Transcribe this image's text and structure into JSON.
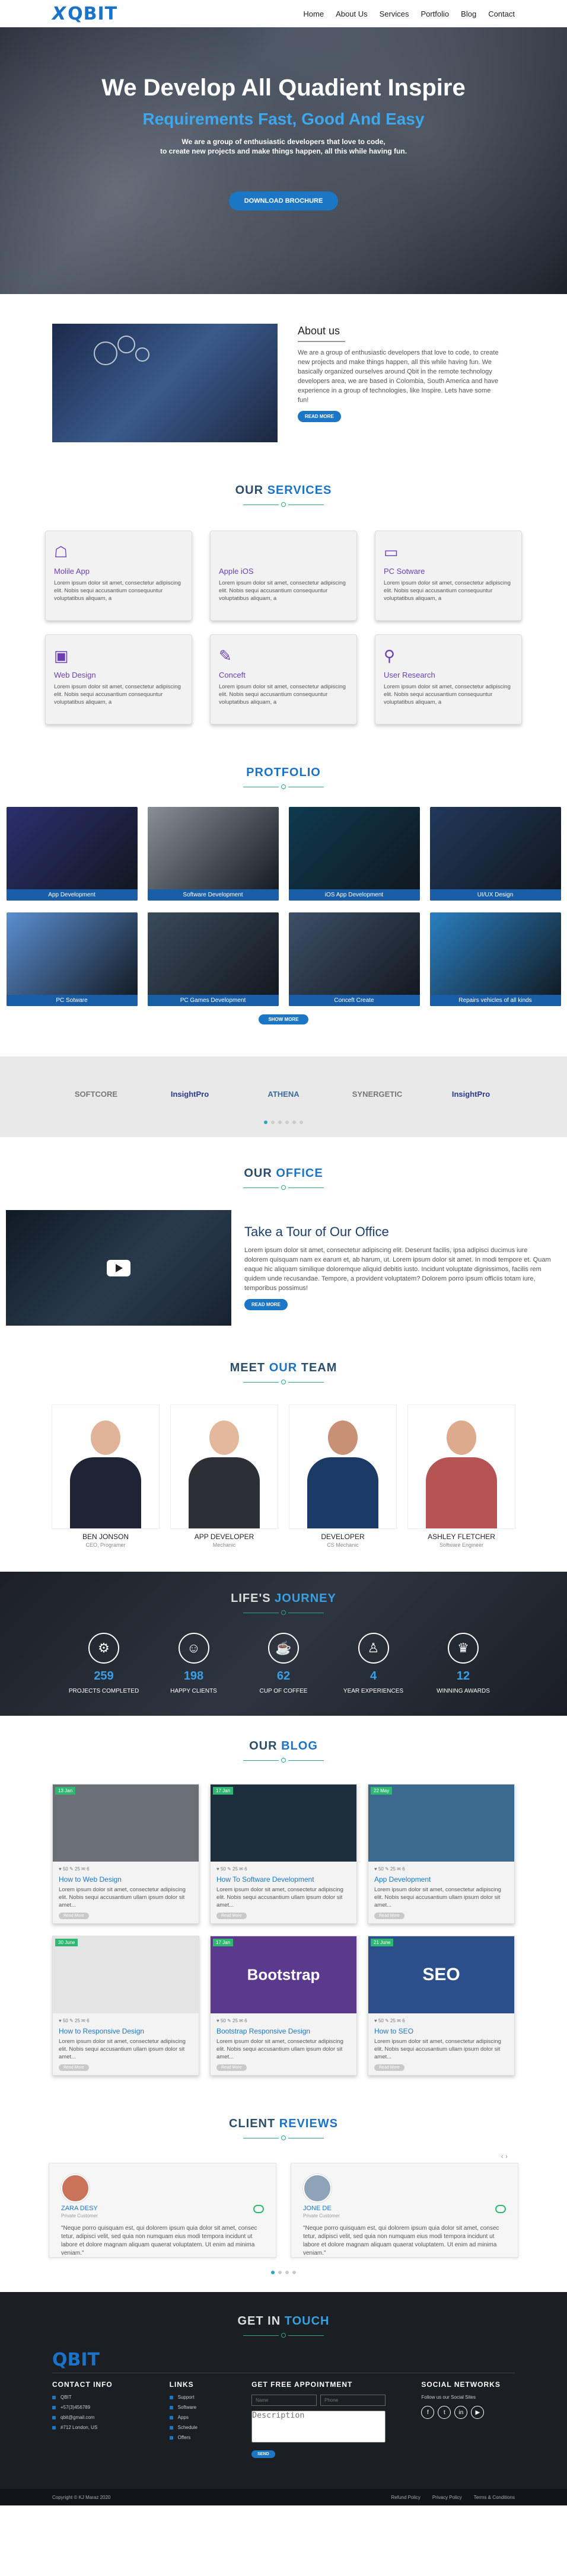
{
  "brand": {
    "logo_mark": "X",
    "logo_text": "QBIT",
    "accent": "#1a73c9"
  },
  "nav": {
    "items": [
      "Home",
      "About Us",
      "Services",
      "Portfolio",
      "Blog",
      "Contact"
    ]
  },
  "hero": {
    "title": "We Develop All Quadient Inspire",
    "subtitle": "Requirements Fast, Good And Easy",
    "line1": "We are a group of enthusiastic developers that love to code,",
    "line2": "to create new projects and make things happen, all this while having fun.",
    "button": "DOWNLOAD BROCHURE"
  },
  "about": {
    "title": "About us",
    "text": "We are a group of enthusiastic developers that love to code, to create new projects and make things happen, all this while having fun. We basically organized ourselves around Qbit in the remote technology developers area, we are based in Colombia, South America and have experience in a group of technologies, like Inspire. Lets have some fun!",
    "button": "READ MORE"
  },
  "services": {
    "title_a": "OUR ",
    "title_b": "SERVICES",
    "items": [
      {
        "icon": "android-icon",
        "glyph": "☖",
        "title": "Molile App",
        "text": "Lorem ipsum dolor sit amet, consectetur adipiscing elit. Nobis sequi accusantium consequuntur voluptatibus aliquam, a"
      },
      {
        "icon": "apple-icon",
        "glyph": "",
        "title": "Apple iOS",
        "text": "Lorem ipsum dolor sit amet, consectetur adipiscing elit. Nobis sequi accusantium consequuntur voluptatibus aliquam, a"
      },
      {
        "icon": "monitor-icon",
        "glyph": "▭",
        "title": "PC Sotware",
        "text": "Lorem ipsum dolor sit amet, consectetur adipiscing elit. Nobis sequi accusantium consequuntur voluptatibus aliquam, a"
      },
      {
        "icon": "web-design-icon",
        "glyph": "▣",
        "title": "Web Design",
        "text": "Lorem ipsum dolor sit amet, consectetur adipiscing elit. Nobis sequi accusantium consequuntur voluptatibus aliquam, a"
      },
      {
        "icon": "idea-icon",
        "glyph": "✎",
        "title": "Conceft",
        "text": "Lorem ipsum dolor sit amet, consectetur adipiscing elit. Nobis sequi accusantium consequuntur voluptatibus aliquam, a"
      },
      {
        "icon": "research-icon",
        "glyph": "⚲",
        "title": "User Research",
        "text": "Lorem ipsum dolor sit amet, consectetur adipiscing elit. Nobis sequi accusantium consequuntur voluptatibus aliquam, a"
      }
    ]
  },
  "portfolio": {
    "title": "PROTFOLIO",
    "items": [
      {
        "label": "App Development",
        "bg": "#2b2f6e"
      },
      {
        "label": "Software Development",
        "bg": "#8a8e96"
      },
      {
        "label": "iOS App Development",
        "bg": "#0e3a4f"
      },
      {
        "label": "UI/UX Design",
        "bg": "#21385a"
      },
      {
        "label": "PC Sotware",
        "bg": "#5a8fd0"
      },
      {
        "label": "PC Games Development",
        "bg": "#3a4a5a"
      },
      {
        "label": "Conceft Create",
        "bg": "#3d4f66"
      },
      {
        "label": "Repairs vehicles of all kinds",
        "bg": "#2a7fc0"
      }
    ],
    "button": "SHOW MORE"
  },
  "clients": {
    "logos": [
      "SOFTCORE",
      "InsightPro",
      "ATHENA",
      "SYNERGETIC",
      "InsightPro"
    ],
    "dots": 6
  },
  "office": {
    "title_a": "OUR ",
    "title_b": "OFFICE",
    "heading": "Take a Tour of Our Office",
    "text": "Lorem ipsum dolor sit amet, consectetur adipiscing elit. Deserunt facilis, ipsa adipisci ducimus iure dolorem quisquam nam ex earum et, ab harum, ut. Lorem ipsum dolor sit amet. In modi tempore et. Quam eaque hic aliquam similique doloremque aliquid debitis iusto. Incidunt voluptate dignissimos, facilis rem quidem unde recusandae. Tempore, a provident voluptatem? Dolorem porro ipsum officiis totam iure, temporibus possimus!",
    "button": "READ MORE"
  },
  "team": {
    "title_a": "MEET ",
    "title_b": "OUR",
    "title_c": " TEAM",
    "members": [
      {
        "name": "BEN JONSON",
        "role": "CEO, Programer",
        "skin": "#e1b49a",
        "shirt": "#1f2336"
      },
      {
        "name": "APP DEVELOPER",
        "role": "Mechanic",
        "skin": "#e4b89c",
        "shirt": "#2c2f35"
      },
      {
        "name": "DEVELOPER",
        "role": "CS Mechanic",
        "skin": "#c89074",
        "shirt": "#1c3a66"
      },
      {
        "name": "ASHLEY FLETCHER",
        "role": "Software Engineer",
        "skin": "#dcaa8c",
        "shirt": "#b65454"
      }
    ]
  },
  "journey": {
    "title_a": "LIFE'S ",
    "title_b": "JOURNEY",
    "items": [
      {
        "icon": "projects-icon",
        "glyph": "⚙",
        "number": "259",
        "label": "PROJECTS COMPLETED"
      },
      {
        "icon": "smile-icon",
        "glyph": "☺",
        "number": "198",
        "label": "HAPPY CLIENTS"
      },
      {
        "icon": "coffee-icon",
        "glyph": "☕",
        "number": "62",
        "label": "CUP OF COFFEE"
      },
      {
        "icon": "experience-icon",
        "glyph": "♙",
        "number": "4",
        "label": "YEAR EXPERIENCES"
      },
      {
        "icon": "trophy-icon",
        "glyph": "♛",
        "number": "12",
        "label": "WINNING AWARDS"
      }
    ]
  },
  "blog": {
    "title_a": "OUR ",
    "title_b": "BLOG",
    "posts": [
      {
        "date": "13 Jan",
        "meta": "♥ 50   ✎ 25   ✉ 6",
        "title": "How to Web Design",
        "text": "Lorem ipsum dolor sit amet, consectetur adipiscing elit. Nobis sequi accusantium ullam ipsum dolor sit amet...",
        "more": "Read More",
        "bg": "#6b6f76"
      },
      {
        "date": "17 Jan",
        "meta": "♥ 50   ✎ 25   ✉ 6",
        "title": "How To Software Development",
        "text": "Lorem ipsum dolor sit amet, consectetur adipiscing elit. Nobis sequi accusantium ullam ipsum dolor sit amet...",
        "more": "Read More",
        "bg": "#1d2e3d"
      },
      {
        "date": "22 May",
        "meta": "♥ 50   ✎ 25   ✉ 6",
        "title": "App Development",
        "text": "Lorem ipsum dolor sit amet, consectetur adipiscing elit. Nobis sequi accusantium ullam ipsum dolor sit amet...",
        "more": "Read More",
        "bg": "#3b6a8e"
      },
      {
        "date": "30 June",
        "meta": "♥ 50   ✎ 25   ✉ 6",
        "title": "How to Responsive Design",
        "text": "Lorem ipsum dolor sit amet, consectetur adipiscing elit. Nobis sequi accusantium ullam ipsum dolor sit amet...",
        "more": "Read More",
        "bg": "#e4e4e4"
      },
      {
        "date": "17 Jan",
        "meta": "♥ 50   ✎ 25   ✉ 6",
        "title": "Bootstrap Responsive Design",
        "text": "Lorem ipsum dolor sit amet, consectetur adipiscing elit. Nobis sequi accusantium ullam ipsum dolor sit amet...",
        "more": "Read More",
        "bg": "#5b3a8e",
        "overlay": "Bootstrap"
      },
      {
        "date": "21 June",
        "meta": "♥ 50   ✎ 25   ✉ 6",
        "title": "How to SEO",
        "text": "Lorem ipsum dolor sit amet, consectetur adipiscing elit. Nobis sequi accusantium ullam ipsum dolor sit amet...",
        "more": "Read More",
        "bg": "#2b4f8a",
        "overlay": "SEO"
      }
    ]
  },
  "reviews": {
    "title_a": "CLIENT ",
    "title_b": "REVIEWS",
    "arrows": "‹   ›",
    "items": [
      {
        "name": "ZARA DESY",
        "title": "Private Customer",
        "text": "\"Neque porro quisquam est, qui dolorem ipsum quia dolor sit amet, consec tetur, adipisci velit, sed quia non numquam eius modi tempora incidunt ut labore et dolore magnam aliquam quaerat voluptatem. Ut enim ad minima veniam.\"",
        "avatar": "#c9745a"
      },
      {
        "name": "JONE DE",
        "title": "Private Customer",
        "text": "\"Neque porro quisquam est, qui dolorem ipsum quia dolor sit amet, consec tetur, adipisci velit, sed quia non numquam eius modi tempora incidunt ut labore et dolore magnam aliquam quaerat voluptatem. Ut enim ad minima veniam.\"",
        "avatar": "#8fa3b8"
      }
    ]
  },
  "footer": {
    "title_a": "GET IN ",
    "title_b": "TOUCH",
    "logo": "QBIT",
    "contact": {
      "heading": "CONTACT INFO",
      "rows": [
        "QBIT",
        "+57(3)456789",
        "qbit@gmail.com",
        "#712 London, US"
      ]
    },
    "links": {
      "heading": "LINKS",
      "rows": [
        "Support",
        "Software",
        "Apps",
        "Schedule",
        "Offers"
      ]
    },
    "appointment": {
      "heading": "GET FREE APPOINTMENT",
      "name": "Name",
      "phone": "Phone",
      "description": "Description",
      "send": "SEND"
    },
    "social": {
      "heading": "SOCIAL NETWORKS",
      "text": "Follow us our Social Sites",
      "icons": [
        "f",
        "t",
        "in",
        "▶"
      ]
    },
    "copyright": "Copyright © KJ Maraz 2020",
    "bottom_links": [
      "Refund Policy",
      "Privacy Policy",
      "Terms & Conditions"
    ]
  }
}
